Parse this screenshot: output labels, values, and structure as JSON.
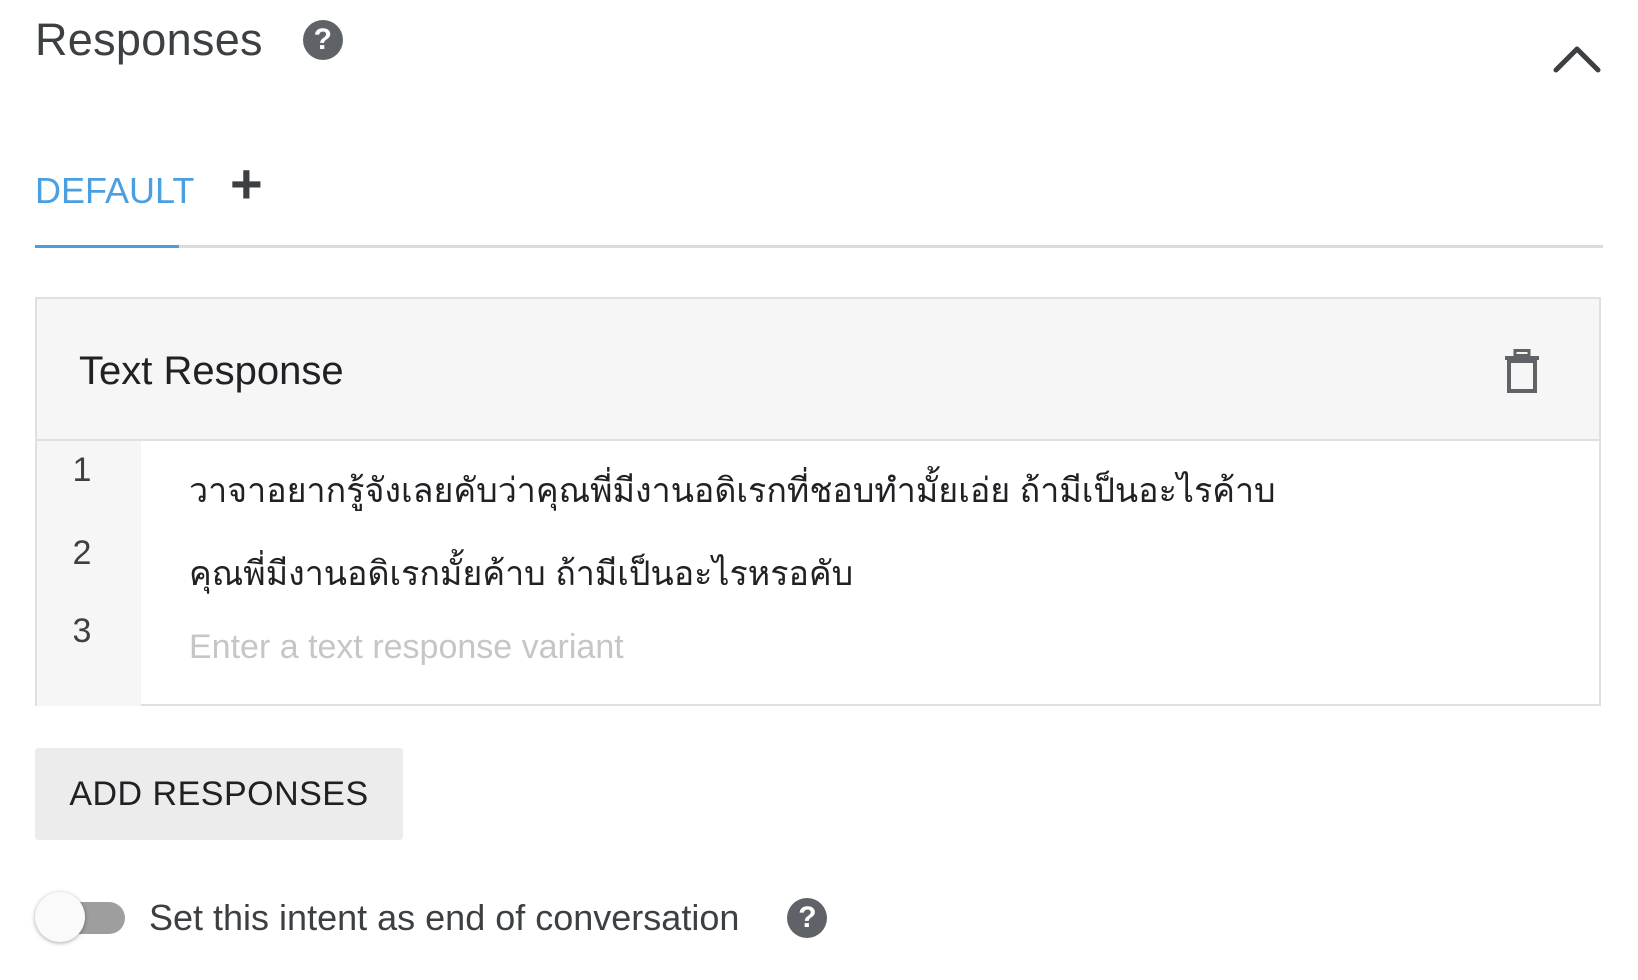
{
  "section": {
    "title": "Responses",
    "help_icon": "question-circle-icon",
    "collapse_icon": "chevron-up-icon"
  },
  "tabs": {
    "active_label": "DEFAULT",
    "add_symbol": "+",
    "accent_color": "#4a9fe0"
  },
  "text_response": {
    "title": "Text Response",
    "delete_icon": "trash-icon",
    "rows": [
      {
        "number": "1",
        "text": "วาจาอยากรู้จังเลยคับว่าคุณพี่มีงานอดิเรกที่ชอบทำมั้ยเอ่ย ถ้ามีเป็นอะไรค้าบ"
      },
      {
        "number": "2",
        "text": "คุณพี่มีงานอดิเรกมั้ยค้าบ ถ้ามีเป็นอะไรหรอคับ"
      },
      {
        "number": "3",
        "value": "",
        "placeholder": "Enter a text response variant"
      }
    ]
  },
  "add_responses": {
    "label": "ADD RESPONSES"
  },
  "end_conversation": {
    "label": "Set this intent as end of conversation",
    "enabled": false
  }
}
